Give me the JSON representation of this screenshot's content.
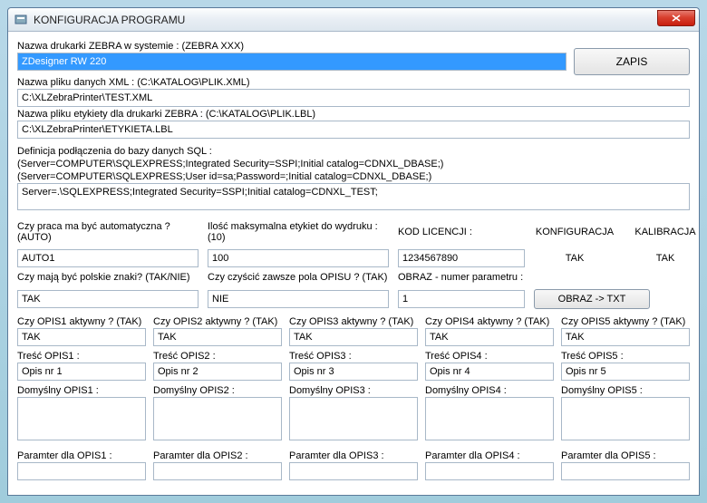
{
  "window": {
    "title": "KONFIGURACJA PROGRAMU"
  },
  "top": {
    "printer_label": "Nazwa drukarki ZEBRA w systemie : (ZEBRA XXX)",
    "printer_value": "ZDesigner RW 220",
    "xml_label": "Nazwa pliku danych XML : (C:\\KATALOG\\PLIK.XML)",
    "xml_value": "C:\\XLZebraPrinter\\TEST.XML",
    "lbl_label": "Nazwa pliku etykiety dla drukarki ZEBRA : (C:\\KATALOG\\PLIK.LBL)",
    "lbl_value": "C:\\XLZebraPrinter\\ETYKIETA.LBL",
    "save_button": "ZAPIS"
  },
  "sql": {
    "def_label": "Definicja podłączenia do bazy danych SQL :",
    "def_line1": "(Server=COMPUTER\\SQLEXPRESS;Integrated Security=SSPI;Initial catalog=CDNXL_DBASE;)",
    "def_line2": "(Server=COMPUTER\\SQLEXPRESS;User id=sa;Password=;Initial catalog=CDNXL_DBASE;)",
    "value": "Server=.\\SQLEXPRESS;Integrated Security=SSPI;Initial catalog=CDNXL_TEST;"
  },
  "mid": {
    "auto_label": "Czy praca ma być automatyczna ? (AUTO)",
    "auto_value": "AUTO1",
    "max_label": "Ilość maksymalna etykiet do wydruku : (10)",
    "max_value": "100",
    "lic_label": "KOD LICENCJI :",
    "lic_value": "1234567890",
    "konf_label": "KONFIGURACJA",
    "konf_value": "TAK",
    "kalib_label": "KALIBRACJA",
    "kalib_value": "TAK",
    "polish_label": "Czy mają być polskie znaki? (TAK/NIE)",
    "polish_value": "TAK",
    "clear_label": "Czy czyścić zawsze pola OPISU ? (TAK)",
    "clear_value": "NIE",
    "obraz_label": "OBRAZ - numer parametru :",
    "obraz_value": "1",
    "obraz_btn": "OBRAZ -> TXT"
  },
  "opis": [
    {
      "active_label": "Czy OPIS1 aktywny ? (TAK)",
      "active_value": "TAK",
      "content_label": "Treść OPIS1 :",
      "content_value": "Opis nr 1",
      "default_label": "Domyślny OPIS1 :",
      "default_value": "",
      "param_label": "Paramter dla OPIS1 :",
      "param_value": ""
    },
    {
      "active_label": "Czy OPIS2 aktywny ? (TAK)",
      "active_value": "TAK",
      "content_label": "Treść OPIS2 :",
      "content_value": "Opis nr 2",
      "default_label": "Domyślny OPIS2 :",
      "default_value": "",
      "param_label": "Paramter dla OPIS2 :",
      "param_value": ""
    },
    {
      "active_label": "Czy OPIS3 aktywny ? (TAK)",
      "active_value": "TAK",
      "content_label": "Treść OPIS3 :",
      "content_value": "Opis nr 3",
      "default_label": "Domyślny OPIS3 :",
      "default_value": "",
      "param_label": "Paramter dla OPIS3 :",
      "param_value": ""
    },
    {
      "active_label": "Czy OPIS4 aktywny ? (TAK)",
      "active_value": "TAK",
      "content_label": "Treść OPIS4 :",
      "content_value": "Opis nr 4",
      "default_label": "Domyślny OPIS4 :",
      "default_value": "",
      "param_label": "Paramter dla OPIS4 :",
      "param_value": ""
    },
    {
      "active_label": "Czy OPIS5 aktywny ? (TAK)",
      "active_value": "TAK",
      "content_label": "Treść OPIS5 :",
      "content_value": "Opis nr 5",
      "default_label": "Domyślny OPIS5 :",
      "default_value": "",
      "param_label": "Paramter dla OPIS5 :",
      "param_value": ""
    }
  ]
}
